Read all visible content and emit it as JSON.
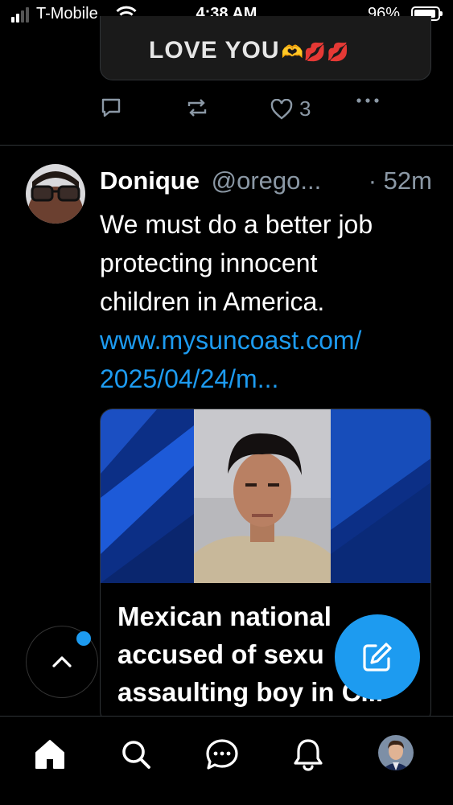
{
  "status_bar": {
    "carrier": "T-Mobile",
    "time": "4:38 AM",
    "battery_percent": "96%",
    "signal_bars": 2,
    "battery_level": 0.96
  },
  "previous_post": {
    "card_text": "LOVE YOU",
    "like_count": "3",
    "icons": [
      "reply-icon",
      "repost-icon",
      "like-icon",
      "more-icon"
    ]
  },
  "post": {
    "display_name": "Donique",
    "handle": "@orego...",
    "time_ago": "· 52m",
    "text_lines": [
      "We must do a better job",
      "protecting innocent",
      "children in America."
    ],
    "link_lines": [
      "www.mysuncoast.com/",
      "2025/04/24/m..."
    ],
    "card_title_lines": [
      "Mexican national",
      "accused of sexu",
      "assaulting boy in C..."
    ]
  },
  "tab_bar": {
    "tabs": [
      "home-icon",
      "search-icon",
      "chat-icon",
      "notifications-icon",
      "profile-avatar"
    ]
  },
  "colors": {
    "accent": "#1d9bf0",
    "secondary_text": "#8b98a5",
    "divider": "#2f3336",
    "heart": "#ff2b50"
  }
}
